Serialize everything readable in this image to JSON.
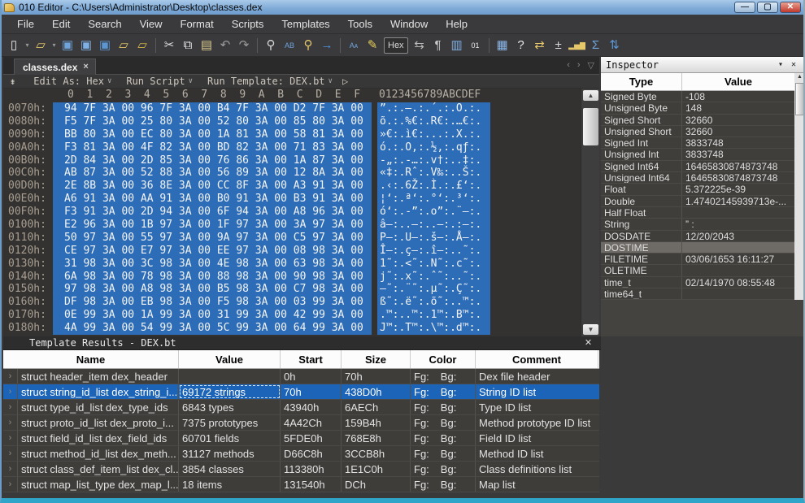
{
  "window": {
    "title": "010 Editor - C:\\Users\\Administrator\\Desktop\\classes.dex",
    "minimize": "—",
    "maximize": "▢",
    "close": "✕"
  },
  "menu": {
    "items": [
      "File",
      "Edit",
      "Search",
      "View",
      "Format",
      "Scripts",
      "Templates",
      "Tools",
      "Window",
      "Help"
    ]
  },
  "toolbar": {
    "hex_label": "Hex",
    "icons": [
      {
        "name": "new-file-icon",
        "glyph": "▯",
        "color": "#eeeeee"
      },
      {
        "name": "new-file-chevron-icon",
        "glyph": "▾",
        "chev": true
      },
      {
        "name": "open-file-icon",
        "glyph": "▱",
        "color": "#e6c76a"
      },
      {
        "name": "open-file-chevron-icon",
        "glyph": "▾",
        "chev": true
      },
      {
        "name": "save-icon",
        "glyph": "▣",
        "color": "#6ea3dc"
      },
      {
        "name": "save-as-icon",
        "glyph": "▣",
        "color": "#7fb0e4"
      },
      {
        "name": "save-all-icon",
        "glyph": "▣",
        "color": "#5b95d2"
      },
      {
        "name": "close-folder-icon",
        "glyph": "▱",
        "color": "#e6c76a"
      },
      {
        "name": "import-folder-icon",
        "glyph": "▱",
        "color": "#d9b74f"
      },
      {
        "name": "sep",
        "sep": true
      },
      {
        "name": "cut-icon",
        "glyph": "✂",
        "color": "#d8d8d8"
      },
      {
        "name": "copy-icon",
        "glyph": "⧉",
        "color": "#e8e8e8"
      },
      {
        "name": "paste-icon",
        "glyph": "▤",
        "color": "#d9c98f"
      },
      {
        "name": "undo-icon",
        "glyph": "↶",
        "color": "#9a9a9a"
      },
      {
        "name": "redo-icon",
        "glyph": "↷",
        "color": "#9a9a9a"
      },
      {
        "name": "sep",
        "sep": true
      },
      {
        "name": "find-icon",
        "glyph": "⚲",
        "color": "#d8d8d8"
      },
      {
        "name": "replace-icon",
        "glyph": "AB",
        "color": "#6ea3dc",
        "small": true
      },
      {
        "name": "find-in-files-icon",
        "glyph": "⚲",
        "color": "#e6c76a"
      },
      {
        "name": "goto-icon",
        "glyph": "→",
        "color": "#4f94e0"
      },
      {
        "name": "sep",
        "sep": true
      },
      {
        "name": "font-icon",
        "glyph": "Aᴀ",
        "color": "#6ea3dc",
        "small": true
      },
      {
        "name": "highlight-icon",
        "glyph": "✎",
        "color": "#e8d05a"
      },
      {
        "name": "hexbtn",
        "hexbtn": true
      },
      {
        "name": "word-wrap-icon",
        "glyph": "⇆",
        "color": "#b8b8b8"
      },
      {
        "name": "pilcrow-icon",
        "glyph": "¶",
        "color": "#c8c8c8"
      },
      {
        "name": "columns-icon",
        "glyph": "▥",
        "color": "#7fb0e4"
      },
      {
        "name": "binary-view-icon",
        "glyph": "01",
        "color": "#e8e8e8",
        "small": true
      },
      {
        "name": "sep",
        "sep": true
      },
      {
        "name": "calculator-icon",
        "glyph": "▦",
        "color": "#8ab4e6"
      },
      {
        "name": "file-info-icon",
        "glyph": "?",
        "color": "#e8e8e8"
      },
      {
        "name": "compare-icon",
        "glyph": "⇄",
        "color": "#e6c76a"
      },
      {
        "name": "checksum-icon",
        "glyph": "±",
        "color": "#d8d8d8"
      },
      {
        "name": "histogram-icon",
        "glyph": "▂▅▇",
        "color": "#e6c76a",
        "small": true
      },
      {
        "name": "stats-icon",
        "glyph": "Σ",
        "color": "#6ea3dc"
      },
      {
        "name": "base-convert-icon",
        "glyph": "⇅",
        "color": "#5b95d2"
      }
    ]
  },
  "tab": {
    "label": "classes.dex",
    "close": "×",
    "nav_prev": "‹",
    "nav_next": "›",
    "nav_menu": "▽"
  },
  "editbar": {
    "jump_icon": "⇟",
    "edit_as": "Edit As: Hex",
    "run_script": "Run Script",
    "run_template": "Run Template: DEX.bt",
    "play": "▷"
  },
  "hex": {
    "col_header": "0  1  2  3  4  5  6  7  8  9  A  B  C  D  E  F",
    "ascii_header": "0123456789ABCDEF",
    "selection_color": "#2d6db8",
    "rows": [
      {
        "addr": "0070h:",
        "bytes": "94 7F 3A 00 96 7F 3A 00 B4 7F 3A 00 D2 7F 3A 00",
        "ascii": "”.:.–.:.´.:.Ò.:."
      },
      {
        "addr": "0080h:",
        "bytes": "F5 7F 3A 00 25 80 3A 00 52 80 3A 00 85 80 3A 00",
        "ascii": "õ.:.%€:.R€:.…€:."
      },
      {
        "addr": "0090h:",
        "bytes": "BB 80 3A 00 EC 80 3A 00 1A 81 3A 00 58 81 3A 00",
        "ascii": "»€:.ì€:...:.X.:."
      },
      {
        "addr": "00A0h:",
        "bytes": "F3 81 3A 00 4F 82 3A 00 BD 82 3A 00 71 83 3A 00",
        "ascii": "ó.:.O‚:.½‚:.qƒ:."
      },
      {
        "addr": "00B0h:",
        "bytes": "2D 84 3A 00 2D 85 3A 00 76 86 3A 00 1A 87 3A 00",
        "ascii": "-„:.-…:.v†:..‡:."
      },
      {
        "addr": "00C0h:",
        "bytes": "AB 87 3A 00 52 88 3A 00 56 89 3A 00 12 8A 3A 00",
        "ascii": "«‡:.Rˆ:.V‰:..Š:."
      },
      {
        "addr": "00D0h:",
        "bytes": "2E 8B 3A 00 36 8E 3A 00 CC 8F 3A 00 A3 91 3A 00",
        "ascii": ".‹:.6Ž:.Ì.:.£‘:."
      },
      {
        "addr": "00E0h:",
        "bytes": "A6 91 3A 00 AA 91 3A 00 B0 91 3A 00 B3 91 3A 00",
        "ascii": "¦‘:.ª‘:.°‘:.³‘:."
      },
      {
        "addr": "00F0h:",
        "bytes": "F3 91 3A 00 2D 94 3A 00 6F 94 3A 00 A8 96 3A 00",
        "ascii": "ó‘:.-”:.o”:.¨–:."
      },
      {
        "addr": "0100h:",
        "bytes": "E2 96 3A 00 1B 97 3A 00 1F 97 3A 00 3A 97 3A 00",
        "ascii": "â–:..—:..—:.:—:."
      },
      {
        "addr": "0110h:",
        "bytes": "50 97 3A 00 55 97 3A 00 9A 97 3A 00 C5 97 3A 00",
        "ascii": "P—:.U—:.š—:.Å—:."
      },
      {
        "addr": "0120h:",
        "bytes": "CE 97 3A 00 E7 97 3A 00 EE 97 3A 00 08 98 3A 00",
        "ascii": "Î—:.ç—:.î—:..˜:."
      },
      {
        "addr": "0130h:",
        "bytes": "31 98 3A 00 3C 98 3A 00 4E 98 3A 00 63 98 3A 00",
        "ascii": "1˜:.<˜:.N˜:.c˜:."
      },
      {
        "addr": "0140h:",
        "bytes": "6A 98 3A 00 78 98 3A 00 88 98 3A 00 90 98 3A 00",
        "ascii": "j˜:.x˜:.ˆ˜:..˜:."
      },
      {
        "addr": "0150h:",
        "bytes": "97 98 3A 00 A8 98 3A 00 B5 98 3A 00 C7 98 3A 00",
        "ascii": "—˜:.¨˜:.µ˜:.Ç˜:."
      },
      {
        "addr": "0160h:",
        "bytes": "DF 98 3A 00 EB 98 3A 00 F5 98 3A 00 03 99 3A 00",
        "ascii": "ß˜:.ë˜:.õ˜:..™:."
      },
      {
        "addr": "0170h:",
        "bytes": "0E 99 3A 00 1A 99 3A 00 31 99 3A 00 42 99 3A 00",
        "ascii": ".™:..™:.1™:.B™:."
      },
      {
        "addr": "0180h:",
        "bytes": "4A 99 3A 00 54 99 3A 00 5C 99 3A 00 64 99 3A 00",
        "ascii": "J™:.T™:.\\™:.d™:."
      }
    ]
  },
  "inspector": {
    "title": "Inspector",
    "menu_icon": "▾",
    "close_icon": "✕",
    "columns": [
      "Type",
      "Value"
    ],
    "rows": [
      {
        "type": "Signed Byte",
        "value": "-108"
      },
      {
        "type": "Unsigned Byte",
        "value": "148"
      },
      {
        "type": "Signed Short",
        "value": "32660"
      },
      {
        "type": "Unsigned Short",
        "value": "32660"
      },
      {
        "type": "Signed Int",
        "value": "3833748"
      },
      {
        "type": "Unsigned Int",
        "value": "3833748"
      },
      {
        "type": "Signed Int64",
        "value": "16465830874873748"
      },
      {
        "type": "Unsigned Int64",
        "value": "16465830874873748"
      },
      {
        "type": "Float",
        "value": "5.372225e-39"
      },
      {
        "type": "Double",
        "value": "1.47402145939713e-..."
      },
      {
        "type": "Half Float",
        "value": ""
      },
      {
        "type": "String",
        "value": "” :"
      },
      {
        "type": "DOSDATE",
        "value": "12/20/2043"
      },
      {
        "type": "DOSTIME",
        "value": "",
        "highlight": true
      },
      {
        "type": "FILETIME",
        "value": "03/06/1653 16:11:27"
      },
      {
        "type": "OLETIME",
        "value": ""
      },
      {
        "type": "time_t",
        "value": "02/14/1970 08:55:48"
      },
      {
        "type": "time64_t",
        "value": ""
      }
    ]
  },
  "template_results": {
    "title": "Template Results - DEX.bt",
    "close_icon": "✕",
    "columns": [
      "Name",
      "Value",
      "Start",
      "Size",
      "Color",
      "Comment"
    ],
    "fg_label": "Fg:",
    "bg_label": "Bg:",
    "row_chevron": "›",
    "selected_color": "#1c64b8",
    "rows": [
      {
        "name": "struct header_item dex_header",
        "value": "",
        "start": "0h",
        "size": "70h",
        "comment": "Dex file header"
      },
      {
        "name": "struct string_id_list dex_string_i...",
        "value": "69172 strings",
        "start": "70h",
        "size": "438D0h",
        "comment": "String ID list",
        "selected": true
      },
      {
        "name": "struct type_id_list dex_type_ids",
        "value": "6843 types",
        "start": "43940h",
        "size": "6AECh",
        "comment": "Type ID list"
      },
      {
        "name": "struct proto_id_list dex_proto_i...",
        "value": "7375 prototypes",
        "start": "4A42Ch",
        "size": "159B4h",
        "comment": "Method prototype ID list"
      },
      {
        "name": "struct field_id_list dex_field_ids",
        "value": "60701 fields",
        "start": "5FDE0h",
        "size": "768E8h",
        "comment": "Field ID list"
      },
      {
        "name": "struct method_id_list dex_meth...",
        "value": "31127 methods",
        "start": "D66C8h",
        "size": "3CCB8h",
        "comment": "Method ID list"
      },
      {
        "name": "struct class_def_item_list dex_cl...",
        "value": "3854 classes",
        "start": "113380h",
        "size": "1E1C0h",
        "comment": "Class definitions list"
      },
      {
        "name": "struct map_list_type dex_map_l...",
        "value": "18 items",
        "start": "131540h",
        "size": "DCh",
        "comment": "Map list"
      }
    ]
  }
}
